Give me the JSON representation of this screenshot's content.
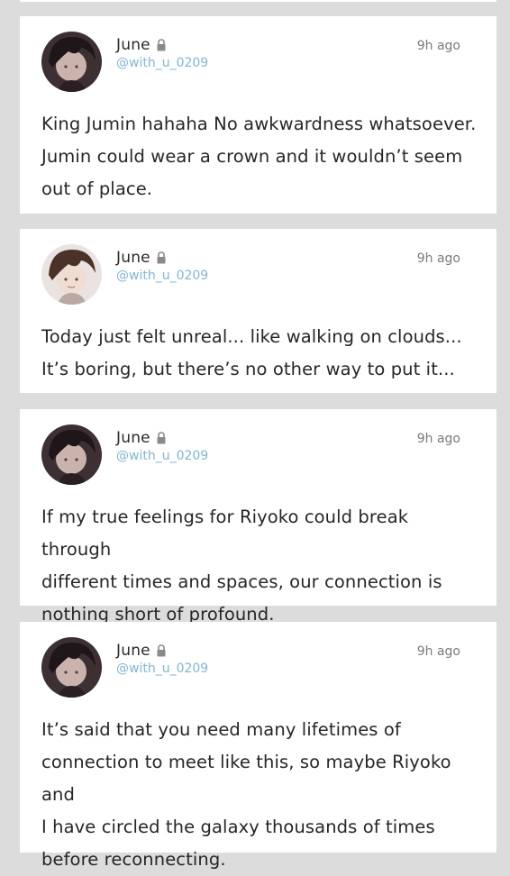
{
  "posts": [
    {
      "author": "June",
      "handle": "@with_u_0209",
      "time": "9h ago",
      "avatar": "dark-avatar",
      "text": "King Jumin hahaha No awkwardness whatsoever.\nJumin could wear a crown and it wouldn’t seem\nout of place."
    },
    {
      "author": "June",
      "handle": "@with_u_0209",
      "time": "9h ago",
      "avatar": "light-avatar",
      "text": "Today just felt unreal... like walking on clouds...\nIt’s boring, but there’s no other way to put it..."
    },
    {
      "author": "June",
      "handle": "@with_u_0209",
      "time": "9h ago",
      "avatar": "dark-avatar",
      "text": "If my true feelings for Riyoko could break through\ndifferent times and spaces, our connection is\nnothing short of profound."
    },
    {
      "author": "June",
      "handle": "@with_u_0209",
      "time": "9h ago",
      "avatar": "dark-avatar",
      "text": "It’s said that you need many lifetimes of\nconnection to meet like this, so maybe Riyoko and\nI have circled the galaxy thousands of times\nbefore reconnecting."
    }
  ],
  "colors": {
    "background": "#dcdcdc",
    "card": "#ffffff",
    "handle": "#7fb6d6",
    "time": "#7a7a7a"
  },
  "icons": {
    "lock": "lock-icon"
  }
}
